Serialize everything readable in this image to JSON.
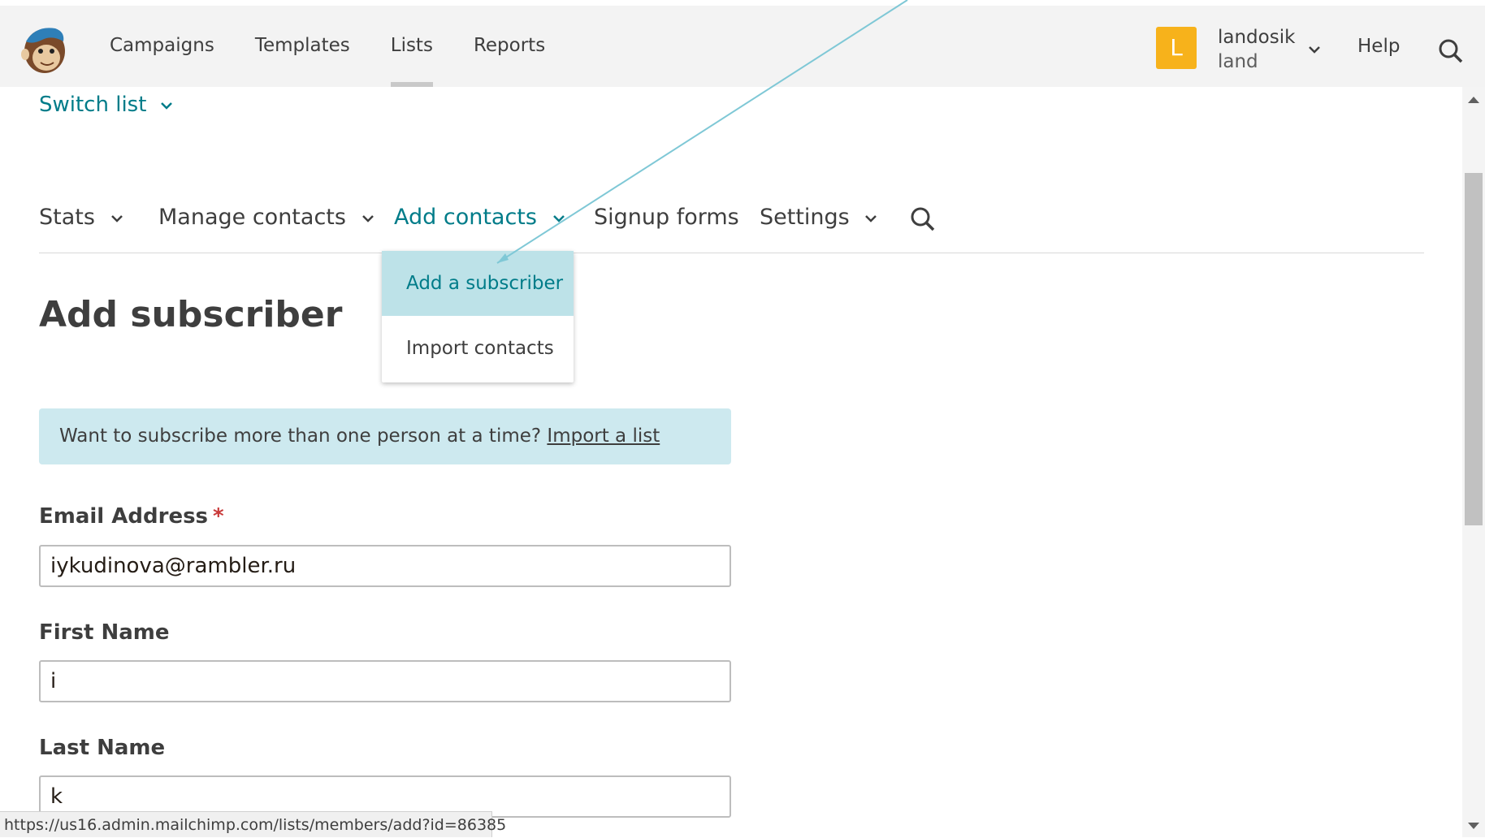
{
  "top_nav": {
    "items": [
      {
        "label": "Campaigns",
        "active": false
      },
      {
        "label": "Templates",
        "active": false
      },
      {
        "label": "Lists",
        "active": true
      },
      {
        "label": "Reports",
        "active": false
      }
    ],
    "avatar_letter": "L",
    "account_name": "landosik",
    "account_sub": "land",
    "help_label": "Help",
    "icons": [
      "freddie-logo-icon",
      "chevron-down-icon",
      "search-icon"
    ]
  },
  "switch_list": {
    "label": "Switch list"
  },
  "sub_nav": {
    "stats": "Stats",
    "manage_contacts": "Manage contacts",
    "add_contacts": "Add contacts",
    "signup_forms": "Signup forms",
    "settings": "Settings"
  },
  "dropdown": {
    "items": [
      {
        "label": "Add a subscriber",
        "highlighted": true
      },
      {
        "label": "Import contacts",
        "highlighted": false
      }
    ]
  },
  "page": {
    "title": "Add subscriber"
  },
  "banner": {
    "text": "Want to subscribe more than one person at a time? ",
    "link": "Import a list"
  },
  "form": {
    "email": {
      "label": "Email Address",
      "required_mark": "*",
      "value": "iykudinova@rambler.ru"
    },
    "first_name": {
      "label": "First Name",
      "value": "i"
    },
    "last_name": {
      "label": "Last Name",
      "value": "k"
    }
  },
  "status_bar": {
    "url": "https://us16.admin.mailchimp.com/lists/members/add?id=86385"
  },
  "colors": {
    "accent": "#007c89",
    "highlight": "#bde2e8",
    "banner": "#cde9ef",
    "avatar": "#f7b21b",
    "required": "#c93a3a"
  }
}
